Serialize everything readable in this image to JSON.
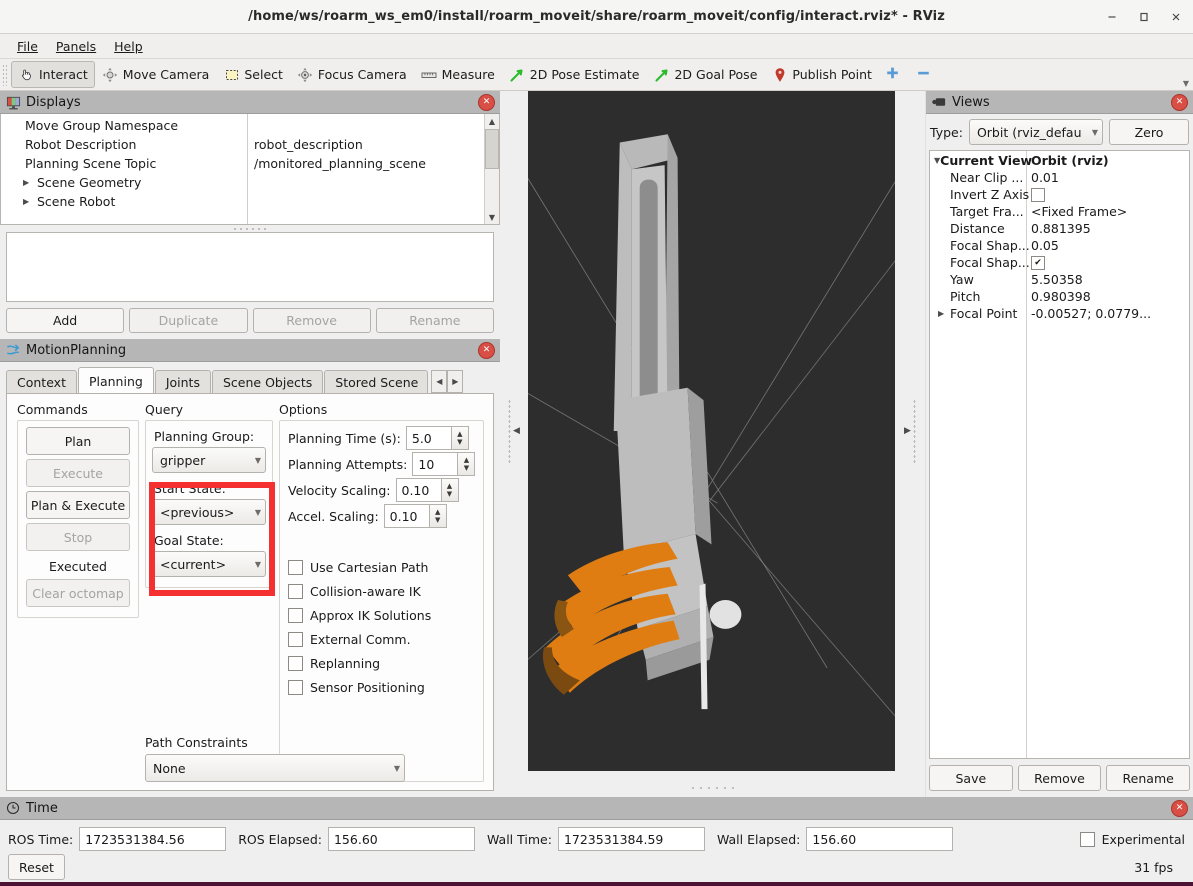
{
  "window": {
    "title": "/home/ws/roarm_ws_em0/install/roarm_moveit/share/roarm_moveit/config/interact.rviz* - RViz",
    "minimize": "–",
    "maximize": "□",
    "close": "✕"
  },
  "menubar": {
    "items": [
      {
        "label": "File",
        "mnemonic": "F"
      },
      {
        "label": "Panels",
        "mnemonic": "P"
      },
      {
        "label": "Help",
        "mnemonic": "H"
      }
    ]
  },
  "toolbar": {
    "items": [
      {
        "label": "Interact",
        "icon": "hand-cursor-icon",
        "active": true
      },
      {
        "label": "Move Camera",
        "icon": "move-camera-icon",
        "active": false
      },
      {
        "label": "Select",
        "icon": "select-rect-icon",
        "active": false
      },
      {
        "label": "Focus Camera",
        "icon": "focus-camera-icon",
        "active": false
      },
      {
        "label": "Measure",
        "icon": "ruler-icon",
        "active": false
      },
      {
        "label": "2D Pose Estimate",
        "icon": "green-arrow-icon",
        "active": false
      },
      {
        "label": "2D Goal Pose",
        "icon": "green-arrow-icon",
        "active": false
      },
      {
        "label": "Publish Point",
        "icon": "map-pin-icon",
        "active": false
      }
    ],
    "plus_icon": "plus-icon",
    "minus_icon": "minus-icon",
    "overflow_icon": "chevron-down-icon"
  },
  "displays": {
    "title": "Displays",
    "icon": "monitor-icon",
    "close_icon": "close-icon",
    "rows": [
      {
        "label": "Move Group Namespace",
        "value": "",
        "expandable": false,
        "indent": 1
      },
      {
        "label": "Robot Description",
        "value": "robot_description",
        "expandable": false,
        "indent": 1
      },
      {
        "label": "Planning Scene Topic",
        "value": "/monitored_planning_scene",
        "expandable": false,
        "indent": 1
      },
      {
        "label": "Scene Geometry",
        "value": "",
        "expandable": true,
        "indent": 0
      },
      {
        "label": "Scene Robot",
        "value": "",
        "expandable": true,
        "indent": 0
      }
    ],
    "buttons": [
      {
        "label": "Add",
        "enabled": true
      },
      {
        "label": "Duplicate",
        "enabled": false
      },
      {
        "label": "Remove",
        "enabled": false
      },
      {
        "label": "Rename",
        "enabled": false
      }
    ]
  },
  "motion_planning": {
    "title": "MotionPlanning",
    "icon": "motion-icon",
    "close_icon": "close-icon",
    "tabs": [
      {
        "label": "Context",
        "selected": false
      },
      {
        "label": "Planning",
        "selected": true
      },
      {
        "label": "Joints",
        "selected": false
      },
      {
        "label": "Scene Objects",
        "selected": false
      },
      {
        "label": "Stored Scene",
        "selected": false
      }
    ],
    "tab_scroll_left": "◀",
    "tab_scroll_right": "▶",
    "commands": {
      "title": "Commands",
      "buttons": [
        {
          "label": "Plan",
          "enabled": true,
          "mnemonic": "P"
        },
        {
          "label": "Execute",
          "enabled": false,
          "mnemonic": "E"
        },
        {
          "label": "Plan & Execute",
          "enabled": true,
          "mnemonic": "x"
        },
        {
          "label": "Stop",
          "enabled": false,
          "mnemonic": "S"
        }
      ],
      "status_text": "Executed",
      "clear_octomap": {
        "label": "Clear octomap",
        "enabled": false
      }
    },
    "query": {
      "title": "Query",
      "planning_group_label": "Planning Group:",
      "planning_group_value": "gripper",
      "start_state_label": "Start State:",
      "start_state_value": "<previous>",
      "goal_state_label": "Goal State:",
      "goal_state_value": "<current>",
      "highlight_color": "#f53030"
    },
    "options": {
      "title": "Options",
      "fields": [
        {
          "label": "Planning Time (s):",
          "value": "5.0"
        },
        {
          "label": "Planning Attempts:",
          "value": "10"
        },
        {
          "label": "Velocity Scaling:",
          "value": "0.10"
        },
        {
          "label": "Accel. Scaling:",
          "value": "0.10"
        }
      ],
      "checkboxes": [
        {
          "label": "Use Cartesian Path",
          "checked": false
        },
        {
          "label": "Collision-aware IK",
          "checked": false
        },
        {
          "label": "Approx IK Solutions",
          "checked": false
        },
        {
          "label": "External Comm.",
          "checked": false
        },
        {
          "label": "Replanning",
          "checked": false
        },
        {
          "label": "Sensor Positioning",
          "checked": false
        }
      ]
    },
    "path_constraints": {
      "title": "Path Constraints",
      "value": "None"
    }
  },
  "view3d": {
    "background_color": "#2d2d2d",
    "grid_color": "#8a8a8a",
    "robot_body_color": "#b5b5b5",
    "robot_accent_color": "#e07b10"
  },
  "views": {
    "title": "Views",
    "icon": "camera-icon",
    "close_icon": "close-icon",
    "type_label": "Type:",
    "type_value": "Orbit (rviz_defau",
    "zero_button": "Zero",
    "tree": [
      {
        "label": "Current View",
        "value": "Orbit (rviz)",
        "bold": true,
        "expandable": true,
        "indent": 0,
        "type": "text"
      },
      {
        "label": "Near Clip ...",
        "value": "0.01",
        "bold": false,
        "expandable": false,
        "indent": 1,
        "type": "text"
      },
      {
        "label": "Invert Z Axis",
        "value": "",
        "bold": false,
        "expandable": false,
        "indent": 1,
        "type": "checkbox",
        "checked": false
      },
      {
        "label": "Target Fra...",
        "value": "<Fixed Frame>",
        "bold": false,
        "expandable": false,
        "indent": 1,
        "type": "text"
      },
      {
        "label": "Distance",
        "value": "0.881395",
        "bold": false,
        "expandable": false,
        "indent": 1,
        "type": "text"
      },
      {
        "label": "Focal Shap...",
        "value": "0.05",
        "bold": false,
        "expandable": false,
        "indent": 1,
        "type": "text"
      },
      {
        "label": "Focal Shap...",
        "value": "",
        "bold": false,
        "expandable": false,
        "indent": 1,
        "type": "checkbox",
        "checked": true
      },
      {
        "label": "Yaw",
        "value": "5.50358",
        "bold": false,
        "expandable": false,
        "indent": 1,
        "type": "text"
      },
      {
        "label": "Pitch",
        "value": "0.980398",
        "bold": false,
        "expandable": false,
        "indent": 1,
        "type": "text"
      },
      {
        "label": "Focal Point",
        "value": "-0.00527; 0.0779...",
        "bold": false,
        "expandable": true,
        "indent": 1,
        "type": "text"
      }
    ],
    "buttons": [
      {
        "label": "Save"
      },
      {
        "label": "Remove"
      },
      {
        "label": "Rename"
      }
    ]
  },
  "time": {
    "title": "Time",
    "icon": "clock-icon",
    "close_icon": "close-icon",
    "fields": [
      {
        "label": "ROS Time:",
        "value": "1723531384.56",
        "width": "w1"
      },
      {
        "label": "ROS Elapsed:",
        "value": "156.60",
        "width": "w2"
      },
      {
        "label": "Wall Time:",
        "value": "1723531384.59",
        "width": "w1"
      },
      {
        "label": "Wall Elapsed:",
        "value": "156.60",
        "width": "w2"
      }
    ],
    "experimental_label": "Experimental",
    "experimental_checked": false,
    "reset_button": "Reset",
    "fps": "31 fps"
  }
}
